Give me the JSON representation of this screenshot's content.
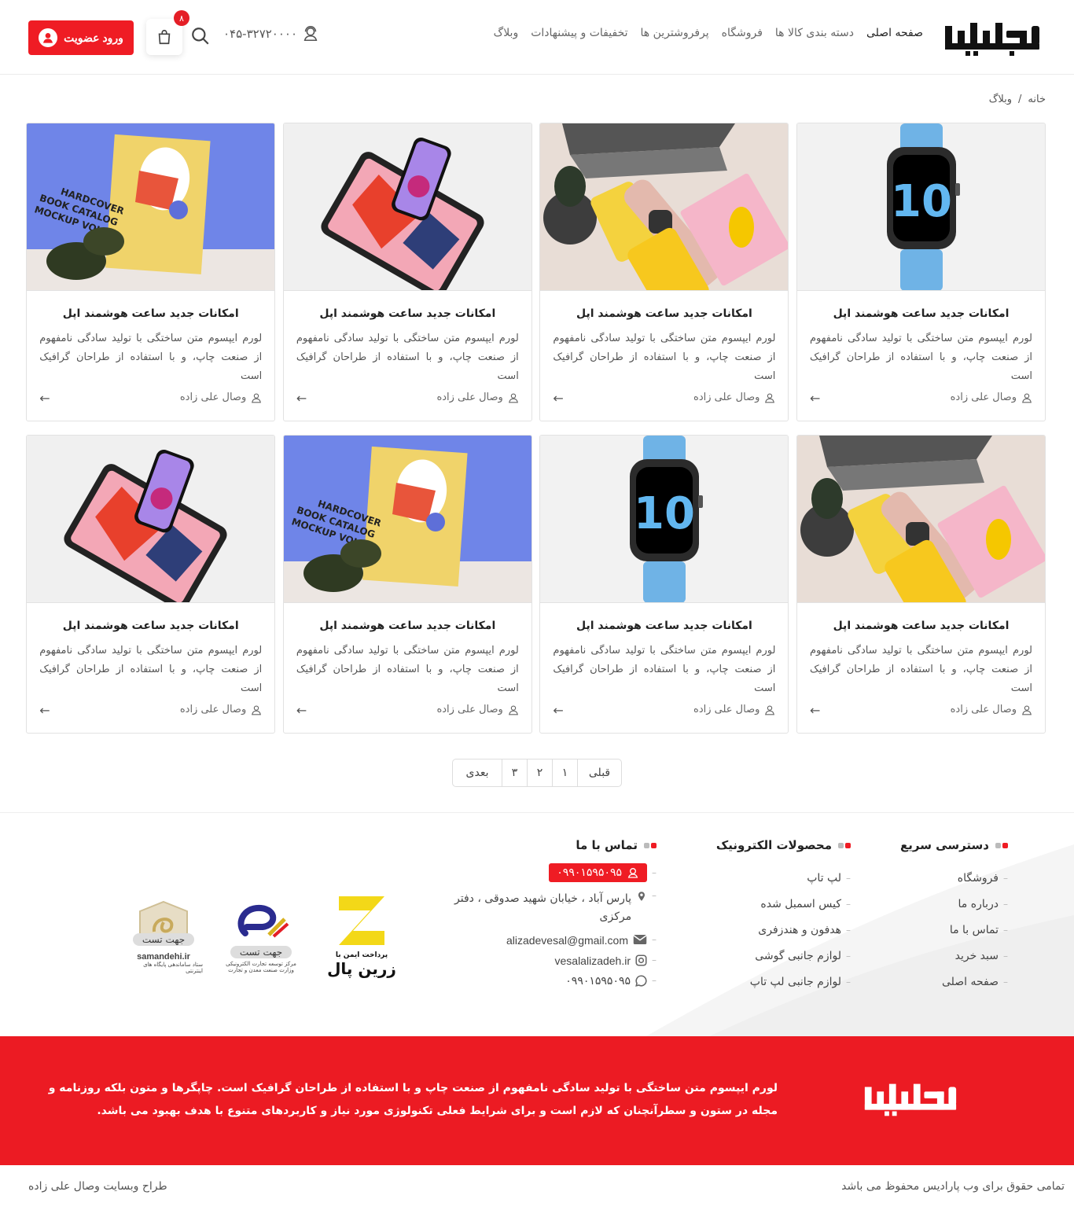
{
  "header": {
    "nav": [
      "صفحه اصلی",
      "دسته بندی کالا ها",
      "فروشگاه",
      "پرفروشترین ها",
      "تخفیفات و پیشنهادات",
      "وبلاگ"
    ],
    "phone": "۰۴۵-۳۲۷۲۰۰۰۰",
    "cart_count": "۸",
    "login_label": "ورود عضویت",
    "brand_color": "#ef1c24"
  },
  "breadcrumb": {
    "home": "خانه",
    "sep": "/",
    "current": "وبلاگ"
  },
  "posts": [
    {
      "title": "امکانات جدید ساعت هوشمند اپل",
      "excerpt": "لورم ایپسوم متن ساختگی با تولید سادگی نامفهوم از صنعت چاپ، و با استفاده از طراحان گرافیک است",
      "author": "وصال علی زاده",
      "image": "watch-icon"
    },
    {
      "title": "امکانات جدید ساعت هوشمند اپل",
      "excerpt": "لورم ایپسوم متن ساختگی با تولید سادگی نامفهوم از صنعت چاپ، و با استفاده از طراحان گرافیک است",
      "author": "وصال علی زاده",
      "image": "desk-icon"
    },
    {
      "title": "امکانات جدید ساعت هوشمند اپل",
      "excerpt": "لورم ایپسوم متن ساختگی با تولید سادگی نامفهوم از صنعت چاپ، و با استفاده از طراحان گرافیک است",
      "author": "وصال علی زاده",
      "image": "tablet-icon"
    },
    {
      "title": "امکانات جدید ساعت هوشمند اپل",
      "excerpt": "لورم ایپسوم متن ساختگی با تولید سادگی نامفهوم از صنعت چاپ، و با استفاده از طراحان گرافیک است",
      "author": "وصال علی زاده",
      "image": "book-icon"
    },
    {
      "title": "امکانات جدید ساعت هوشمند اپل",
      "excerpt": "لورم ایپسوم متن ساختگی با تولید سادگی نامفهوم از صنعت چاپ، و با استفاده از طراحان گرافیک است",
      "author": "وصال علی زاده",
      "image": "desk-icon"
    },
    {
      "title": "امکانات جدید ساعت هوشمند اپل",
      "excerpt": "لورم ایپسوم متن ساختگی با تولید سادگی نامفهوم از صنعت چاپ، و با استفاده از طراحان گرافیک است",
      "author": "وصال علی زاده",
      "image": "watch-icon"
    },
    {
      "title": "امکانات جدید ساعت هوشمند اپل",
      "excerpt": "لورم ایپسوم متن ساختگی با تولید سادگی نامفهوم از صنعت چاپ، و با استفاده از طراحان گرافیک است",
      "author": "وصال علی زاده",
      "image": "book-icon"
    },
    {
      "title": "امکانات جدید ساعت هوشمند اپل",
      "excerpt": "لورم ایپسوم متن ساختگی با تولید سادگی نامفهوم از صنعت چاپ، و با استفاده از طراحان گرافیک است",
      "author": "وصال علی زاده",
      "image": "tablet-icon"
    }
  ],
  "pagination": {
    "prev": "قبلی",
    "pages": [
      "۱",
      "۲",
      "۳"
    ],
    "next": "بعدی"
  },
  "footer": {
    "quick_access": {
      "title": "دسترسی سریع",
      "items": [
        "فروشگاه",
        "درباره ما",
        "تماس با ما",
        "سبد خرید",
        "صفحه اصلی"
      ]
    },
    "electronics": {
      "title": "محصولات الکترونیک",
      "items": [
        "لپ تاپ",
        "کیس اسمبل شده",
        "هدفون و هندزفری",
        "لوازم جانبی گوشی",
        "لوازم جانبی لپ تاپ"
      ]
    },
    "contact": {
      "title": "تماس با ما",
      "phone": "۰۹۹۰۱۵۹۵۰۹۵",
      "address": "پارس آباد ، خیابان شهید صدوقی ، دفتر مرکزی",
      "email": "alizadevesal@gmail.com",
      "instagram": "vesalalizadeh.ir",
      "whatsapp": "۰۹۹۰۱۵۹۵۰۹۵"
    },
    "badges": {
      "zarinpal_top": "پرداخت ایمن با",
      "zarinpal_name": "زرین پال",
      "enamad_label": "جهت تست",
      "enamad_sub": "مرکز توسعه تجارت الکترونیکی",
      "enamad_sub2": "وزارت صنعت معدن و تجارت",
      "samandehi_label": "جهت تست",
      "samandehi_site": "samandehi.ir",
      "samandehi_sub": "ستاد ساماندهی پایگاه های اینترنتی"
    },
    "about_text": "لورم ایپسوم متن ساختگی با تولید سادگی نامفهوم از صنعت چاپ و با استفاده از طراحان گرافیک است. چاپگرها و متون بلکه روزنامه و مجله در ستون و سطرآنچنان که لازم است و برای شرایط فعلی تکنولوژی مورد نیاز و کاربردهای متنوع با هدف بهبود می باشد.",
    "copyright": "تمامی حقوق برای وب پارادیس محفوظ می باشد",
    "designer": "طراح وبسایت وصال علی زاده"
  }
}
